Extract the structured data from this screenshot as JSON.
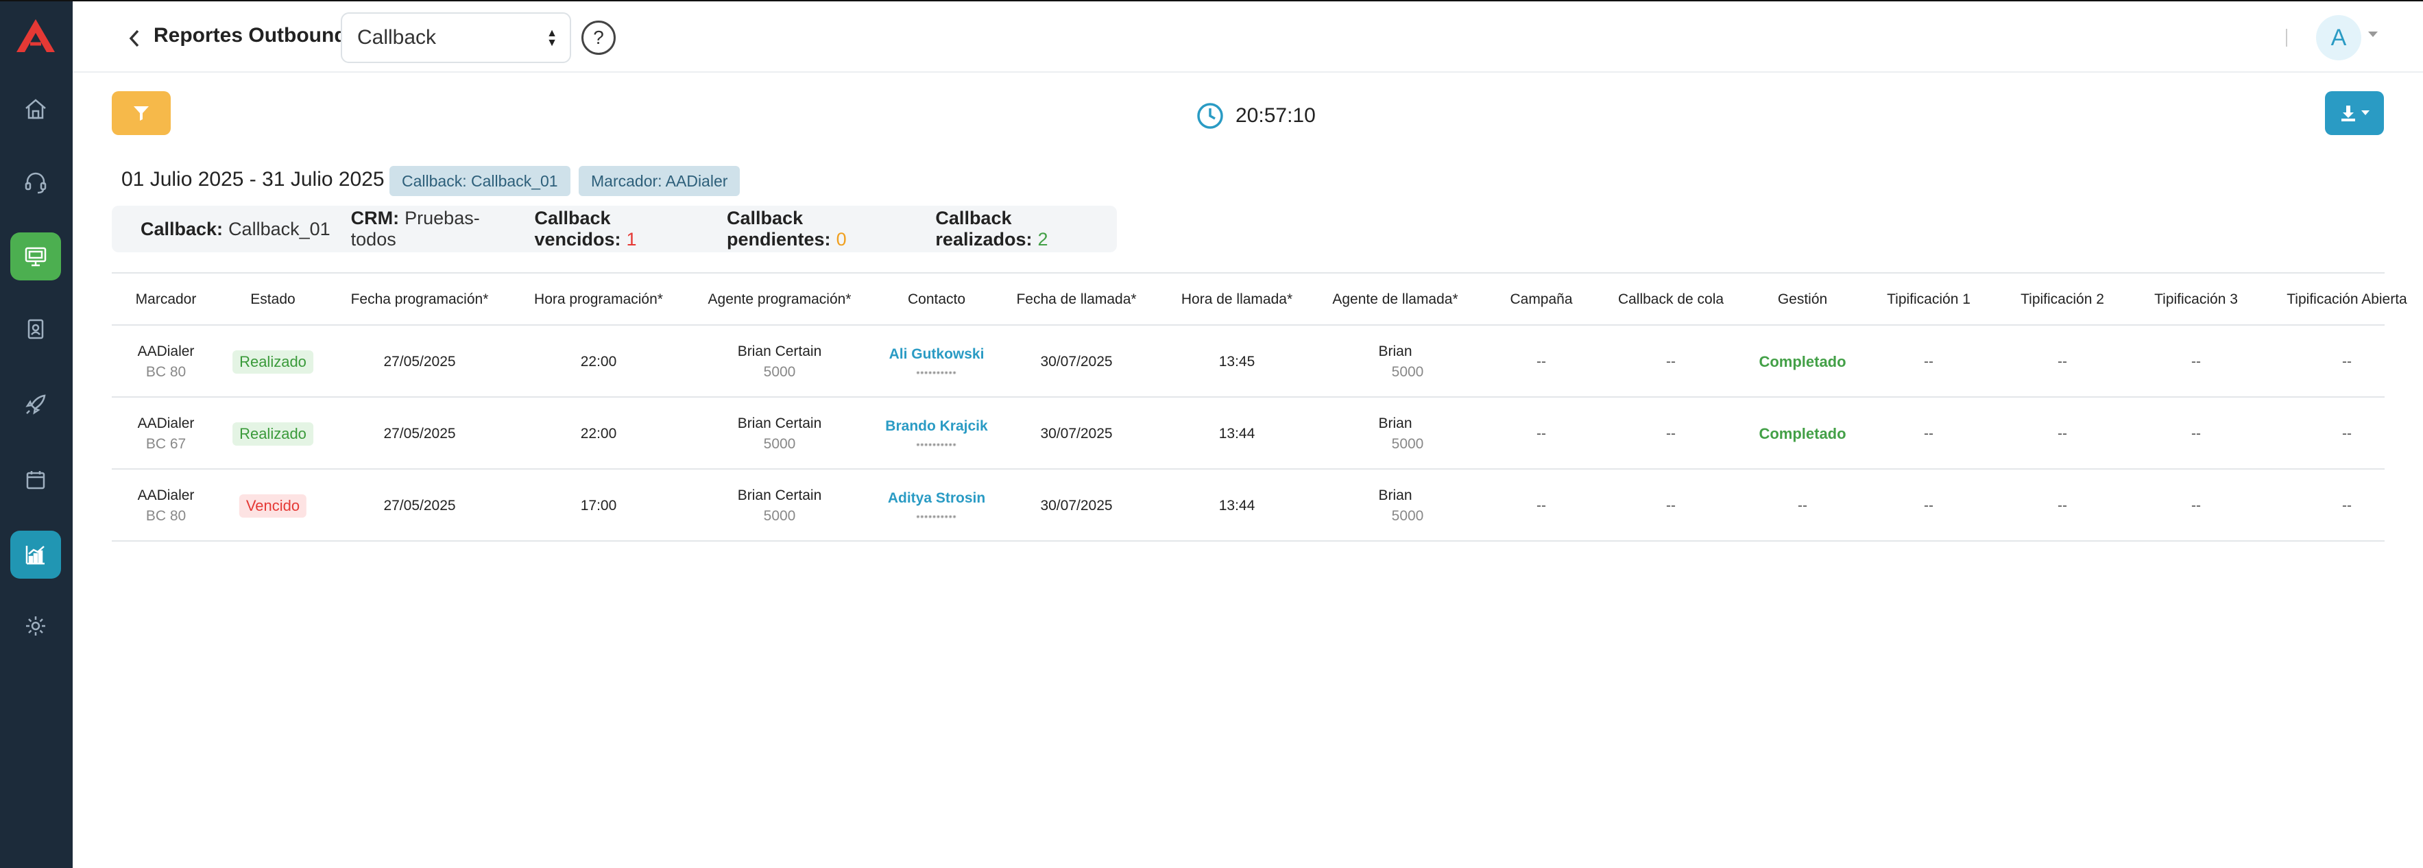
{
  "header": {
    "report_label": "Reportes Outbound:",
    "report_selected": "Callback",
    "help_label": "?",
    "avatar_initial": "A"
  },
  "toolbar": {
    "clock_time": "20:57:10"
  },
  "range_label": "01 Julio 2025 - 31 Julio 2025",
  "tags": [
    "Callback: Callback_01",
    "Marcador: AADialer"
  ],
  "summary": {
    "callback_label": "Callback:",
    "callback_value": "Callback_01",
    "crm_label": "CRM:",
    "crm_value": "Pruebas-todos",
    "vencidos_label": "Callback vencidos:",
    "vencidos_value": "1",
    "pendientes_label": "Callback pendientes:",
    "pendientes_value": "0",
    "realizados_label": "Callback realizados:",
    "realizados_value": "2"
  },
  "table": {
    "columns": [
      "Marcador",
      "Estado",
      "Fecha programación*",
      "Hora programación*",
      "Agente programación*",
      "Contacto",
      "Fecha de llamada*",
      "Hora de llamada*",
      "Agente de llamada*",
      "Campaña",
      "Callback de cola",
      "Gestión",
      "Tipificación 1",
      "Tipificación 2",
      "Tipificación 3",
      "Tipificación Abierta"
    ],
    "rows": [
      {
        "marcador": "AADialer",
        "marcador_sub": "BC 80",
        "estado": "Realizado",
        "estado_type": "ok",
        "fecha_prog": "27/05/2025",
        "hora_prog": "22:00",
        "agente_prog": "Brian Certain",
        "agente_prog_sub": "5000",
        "contacto": "Ali Gutkowski",
        "contacto_phone": "••••••••••",
        "fecha_llamada": "30/07/2025",
        "hora_llamada": "13:45",
        "agente_llamada": "Brian",
        "agente_llamada_sub": "5000",
        "campana": "--",
        "cola": "--",
        "gestion": "Completado",
        "tip1": "--",
        "tip2": "--",
        "tip3": "--",
        "tip_abierta": "--"
      },
      {
        "marcador": "AADialer",
        "marcador_sub": "BC 67",
        "estado": "Realizado",
        "estado_type": "ok",
        "fecha_prog": "27/05/2025",
        "hora_prog": "22:00",
        "agente_prog": "Brian Certain",
        "agente_prog_sub": "5000",
        "contacto": "Brando Krajcik",
        "contacto_phone": "••••••••••",
        "fecha_llamada": "30/07/2025",
        "hora_llamada": "13:44",
        "agente_llamada": "Brian",
        "agente_llamada_sub": "5000",
        "campana": "--",
        "cola": "--",
        "gestion": "Completado",
        "tip1": "--",
        "tip2": "--",
        "tip3": "--",
        "tip_abierta": "--"
      },
      {
        "marcador": "AADialer",
        "marcador_sub": "BC 80",
        "estado": "Vencido",
        "estado_type": "late",
        "fecha_prog": "27/05/2025",
        "hora_prog": "17:00",
        "agente_prog": "Brian Certain",
        "agente_prog_sub": "5000",
        "contacto": "Aditya Strosin",
        "contacto_phone": "••••••••••",
        "fecha_llamada": "30/07/2025",
        "hora_llamada": "13:44",
        "agente_llamada": "Brian",
        "agente_llamada_sub": "5000",
        "campana": "--",
        "cola": "--",
        "gestion": "--",
        "tip1": "--",
        "tip2": "--",
        "tip3": "--",
        "tip_abierta": "--"
      }
    ]
  },
  "colors": {
    "sidebar_bg": "#1c2b3a",
    "accent_green": "#4caf50",
    "accent_teal": "#2196b3",
    "filter_yellow": "#f6b94a",
    "download_blue": "#2a9bc4"
  }
}
